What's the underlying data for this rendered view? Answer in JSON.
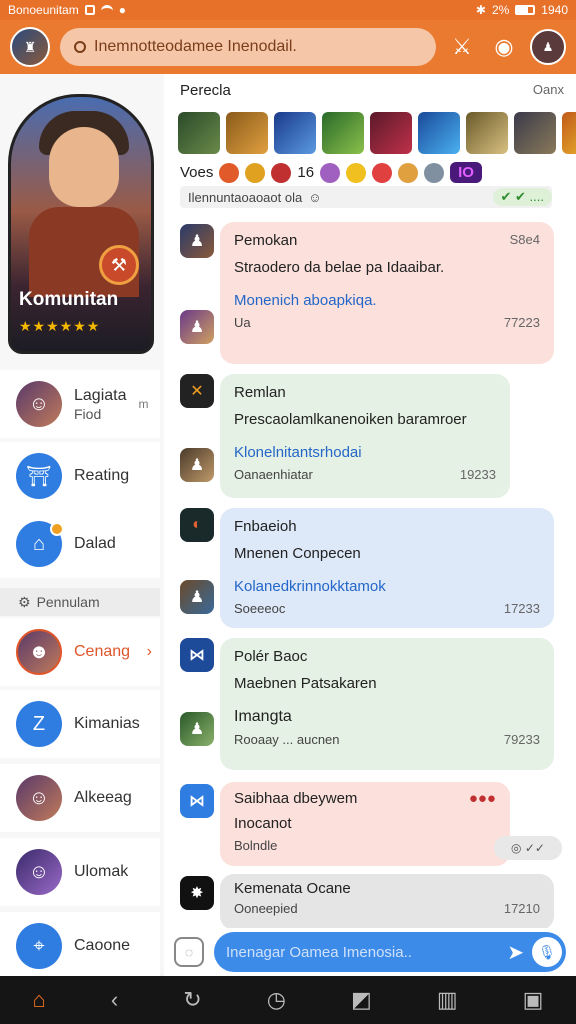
{
  "status_bar": {
    "left_text": "Bonoeunitam",
    "right_text": "1940",
    "battery_label": "2%"
  },
  "top_bar": {
    "search_placeholder": "Inemnotteodamee Inenodail."
  },
  "sidebar": {
    "hero_title": "Komunitan",
    "hero_stars": "★★★★★★",
    "items_top": [
      {
        "label": "Lagiata",
        "sub": "Fiod",
        "icon": "portrait-icon"
      },
      {
        "label": "Reating",
        "icon": "bell-icon"
      },
      {
        "label": "Dalad",
        "icon": "bag-icon"
      }
    ],
    "section_label": "Pennulam",
    "items_bottom": [
      {
        "label": "Cenang",
        "icon": "portrait-icon",
        "active": true
      },
      {
        "label": "Kimanias",
        "icon": "z-logo-icon"
      },
      {
        "label": "Alkeeag",
        "icon": "portrait-icon"
      },
      {
        "label": "Ulomak",
        "icon": "portrait-icon"
      },
      {
        "label": "Caoone",
        "icon": "pin-icon"
      }
    ]
  },
  "main": {
    "header_title": "Perecla",
    "header_right": "Oanx",
    "emoji_row_label": "Voes",
    "emoji_row_num": "16",
    "emoji_row_pill": "IO",
    "notice_text": "Ilennuntaoaoaot ola",
    "notice_ok": "✔ ✔ ....",
    "messages": [
      {
        "name": "Pemokan",
        "text": "Straodero da belae pa Idaaibar.",
        "sub": "Monenich aboapkiqa.",
        "footer": "Ua",
        "time": "77223",
        "right_time": "S8e4",
        "color": "pink"
      },
      {
        "name": "Remlan",
        "text": "Prescaolamlkanenoiken baramroer",
        "sub": "Klonelnitantsrhodai",
        "footer": "Oanaenhiatar",
        "time": "19233",
        "color": "green"
      },
      {
        "name": "Fnbaeioh",
        "text": "Mnenen Conpecen",
        "sub": "Kolanedkrinnokktamok",
        "footer": "Soeeeoc",
        "time": "17233",
        "color": "blue"
      },
      {
        "name": "Polér Baoc",
        "text": "Maebnen Patsakaren",
        "sub": "Imangta",
        "footer": "Rooaay ... aucnen",
        "time": "79233",
        "color": "green"
      },
      {
        "name": "Saibhaa dbeywem",
        "text": "Inocanot",
        "footer": "Bolndle",
        "color": "pink"
      },
      {
        "name": "Kemenata Ocane",
        "footer": "Ooneepied",
        "time": "17210",
        "color": "grey"
      }
    ]
  },
  "composer": {
    "placeholder": "Inenagar Oamea Imenosia.."
  },
  "colors": {
    "accent": "#e97a2f",
    "link": "#2467c8",
    "composer": "#3d8be8"
  }
}
